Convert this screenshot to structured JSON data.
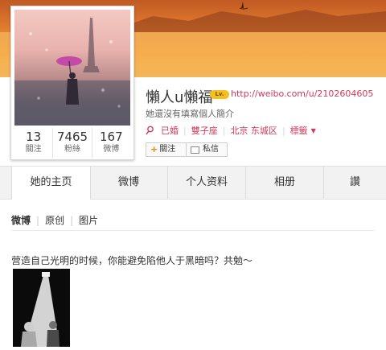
{
  "profile": {
    "name": "懶人u懶福",
    "vip_badge": "Lv.",
    "url": "http://weibo.com/u/2102604605",
    "bio": "她還沒有填寫個人簡介",
    "info": {
      "relationship": "已婚",
      "zodiac": "雙子座",
      "location": "北京 东城区",
      "tags": "標籤"
    },
    "follow_label": "關注",
    "message_label": "私信"
  },
  "counts": [
    {
      "value": "13",
      "label": "關注"
    },
    {
      "value": "7465",
      "label": "粉絲"
    },
    {
      "value": "167",
      "label": "微博"
    }
  ],
  "tabs": [
    {
      "label": "她的主页",
      "active": true
    },
    {
      "label": "微博",
      "active": false
    },
    {
      "label": "个人资料",
      "active": false
    },
    {
      "label": "相册",
      "active": false
    },
    {
      "label": "讚",
      "active": false
    }
  ],
  "subnav": {
    "weibo": "微博",
    "original": "原创",
    "pictures": "图片"
  },
  "post": {
    "text": "营造自己光明的时候，你能避免陷他人于黑暗吗？共勉～"
  },
  "icons": {
    "location": "location-pin-icon",
    "tag_dropdown": "chevron-down-icon",
    "follow": "plus-icon",
    "message": "envelope-icon"
  },
  "colors": {
    "link": "#d2385a",
    "accent_plus": "#f18400",
    "vip": "#f6c01c"
  }
}
